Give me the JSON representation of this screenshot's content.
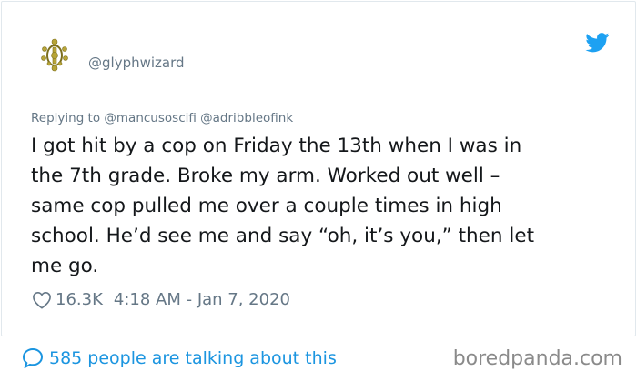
{
  "tweet": {
    "handle": "@glyphwizard",
    "replying_prefix": "Replying to ",
    "replying_to": "@mancusoscifi @adribbleofink",
    "text": "I got hit by a cop on Friday the 13th when I was in\nthe 7th grade. Broke my arm. Worked out well –\nsame cop pulled me over a couple times in high\nschool. He’d see me and say “oh, it’s you,” then let\nme go.",
    "likes": "16.3K",
    "timestamp": "4:18 AM - Jan 7, 2020"
  },
  "footer": {
    "talking": "585 people are talking about this",
    "watermark": "boredpanda.com"
  },
  "colors": {
    "twitter_blue": "#1da1f2",
    "link_blue": "#1b95e0",
    "muted": "#657786",
    "text": "#14171a",
    "avatar_gold": "#b7a437"
  },
  "icons": {
    "brand": "twitter-bird-icon",
    "like": "heart-outline-icon",
    "talk": "speech-bubble-icon",
    "avatar": "glyph-avatar"
  }
}
